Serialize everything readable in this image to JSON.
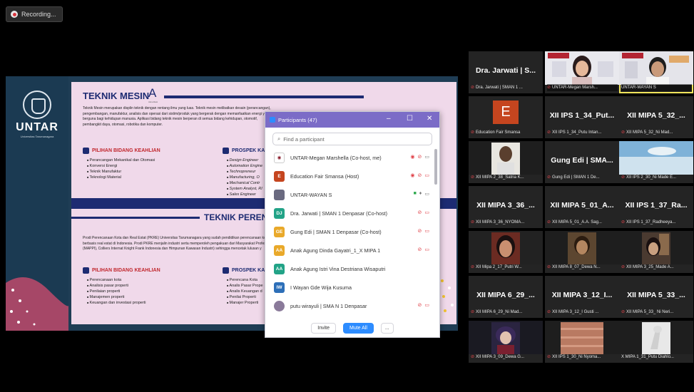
{
  "recording": {
    "label": "Recording..."
  },
  "slide": {
    "logo_text": "UNTAR",
    "logo_sub": "Universitas Tarumanagara",
    "title1": "TEKNIK MESIN",
    "title1_grade": "A",
    "title1_grade_sub": "Akreditasi",
    "para1": "Teknik Mesin merupakan displin teknik dengan rentang ilmu yang luas. Teknik mesin melibatkan desain (perancangan), pengembangan, manufaktur, analisis dan operasi dari sistim/produk yang bergerak dengan memanfaatkan energi yang berguna bagi kehidupan manusia. Aplikasi bidang teknik mesin berperan di semua bidang kehidupan, otomotif, pembangkit daya, otomasi, robotika dan komputer.",
    "sec1_title": "PILIHAN BIDANG KEAHLIAN",
    "sec1_items": [
      "Perancangan Mekanikal dan Otomasi",
      "Konversi Energi",
      "Teknik Manufaktur",
      "Teknologi Material"
    ],
    "sec2_title": "PROSPEK KA",
    "sec2_items": [
      "Design Engineer",
      "Automation Engine",
      "Technopreneur",
      "Manufacturing, O",
      "Mechanical Contr",
      "System Analyst, RI",
      "Sales Engineer"
    ],
    "title2": "TEKNIK PEREN",
    "para2": "Prodi Perencanaan Kota dan Real Estat (PKRE) Universitas Tarumanagara yang sudah pendidikan perencanaan kota berbasis real estat di Indonesia. Prodi PKRE menjalin industri serta memperoleh pengakuan dari Masyarakat Profesi (MAPPI), Colliers Internat Knight Frank Indonesia dan Himpunan Kawasan Industri) sehingga mencetak lulusan y",
    "sec3_title": "PILIHAN BIDANG KEAHLIAN",
    "sec3_items": [
      "Perencanaan kota",
      "Analisis pasar properti",
      "Penilaian properti",
      "Manajemen properti",
      "Keuangan dan investasi properti"
    ],
    "sec4_title": "PROSPEK KAR",
    "sec4_items": [
      "Perencana Kota",
      "Analis Pasar Prope",
      "Analis Keuangan d",
      "Penilai Properti",
      "Manajer Properti"
    ]
  },
  "participants_window": {
    "title": "Participants (47)",
    "search_placeholder": "Find a participant",
    "participants": [
      {
        "initials": "",
        "name": "UNTAR-Megan Marshella (Co-host, me)",
        "color": "#ffffff"
      },
      {
        "initials": "E",
        "name": "Education Fair Smansa (Host)",
        "color": "#c5451f"
      },
      {
        "initials": "",
        "name": "UNTAR-WAYAN S",
        "color": "#6a6a80"
      },
      {
        "initials": "DJ",
        "name": "Dra. Jarwati | SMAN 1 Denpasar (Co-host)",
        "color": "#22a387"
      },
      {
        "initials": "GE",
        "name": "Gung Edi | SMAN 1 Denpasar (Co-host)",
        "color": "#e9a92a"
      },
      {
        "initials": "AA",
        "name": "Anak Agung Dinda Gayatri_1_X MIPA 1",
        "color": "#e9a92a"
      },
      {
        "initials": "AA",
        "name": "Anak Agung Istri Vina Destriana Wisaputri",
        "color": "#22a387"
      },
      {
        "initials": "IW",
        "name": "I Wayan Gde Wija Kusuma",
        "color": "#2d6fb8"
      },
      {
        "initials": "",
        "name": "putu wirayuli | SMA N 1 Denpasar",
        "color": "#8a7a9a"
      }
    ],
    "invite_label": "Invite",
    "mute_all_label": "Mute All",
    "more_label": "..."
  },
  "gallery": [
    {
      "name": "Dra. Jarwati | S...",
      "label": "Dra. Jarwati | SMAN 1 ...",
      "type": "name"
    },
    {
      "name": "",
      "label": "UNTAR-Megan Marsh...",
      "type": "video"
    },
    {
      "name": "",
      "label": "UNTAR-WAYAN S",
      "type": "video"
    },
    {
      "name": "E",
      "label": "Education Fair Smansa",
      "type": "avatar"
    },
    {
      "name": "XII IPS 1_34_Put...",
      "label": "XII IPS 1_34_Putu Intan...",
      "type": "name"
    },
    {
      "name": "XII MIPA 5_32_...",
      "label": "XII MIPA 5_32_Ni Mad...",
      "type": "name"
    },
    {
      "name": "",
      "label": "XII MIPA 2_38_Satria K...",
      "type": "video"
    },
    {
      "name": "Gung Edi | SMA...",
      "label": "Gung Edi | SMAN 1 De...",
      "type": "name"
    },
    {
      "name": "",
      "label": "XII IPS 2_30_Ni Made E...",
      "type": "video"
    },
    {
      "name": "XII MIPA 3_36_...",
      "label": "XII MIPA 3_36_NYOMA...",
      "type": "name"
    },
    {
      "name": "XII MIPA 5_01_A...",
      "label": "XII MIPA 5_01_A.A. Sag...",
      "type": "name"
    },
    {
      "name": "XII IPS 1_37_Ra...",
      "label": "XII IPS 1_37_Radheeya...",
      "type": "name"
    },
    {
      "name": "",
      "label": "XII Mipa 2_17_Putri W...",
      "type": "video"
    },
    {
      "name": "",
      "label": "XII MIPA 8_07_Dewa N...",
      "type": "video"
    },
    {
      "name": "",
      "label": "XII MIPA 3_25_Made A...",
      "type": "video"
    },
    {
      "name": "XII MIPA 6_29_...",
      "label": "XII MIPA 6_29_Ni Mad...",
      "type": "name"
    },
    {
      "name": "XII MIPA 3_12_I...",
      "label": "XII MIPA 3_12_I Gusti ...",
      "type": "name"
    },
    {
      "name": "XII MIPA 5_33_...",
      "label": "XII MIPA 5_33_ Ni Neri...",
      "type": "name"
    },
    {
      "name": "",
      "label": "XII MIPA 3_09_Dewa G...",
      "type": "video"
    },
    {
      "name": "",
      "label": "XII IPS 1_30_Ni Nyoma...",
      "type": "video"
    },
    {
      "name": "",
      "label": "X MIPA 1_31_Putu Diahlo...",
      "type": "video"
    }
  ]
}
